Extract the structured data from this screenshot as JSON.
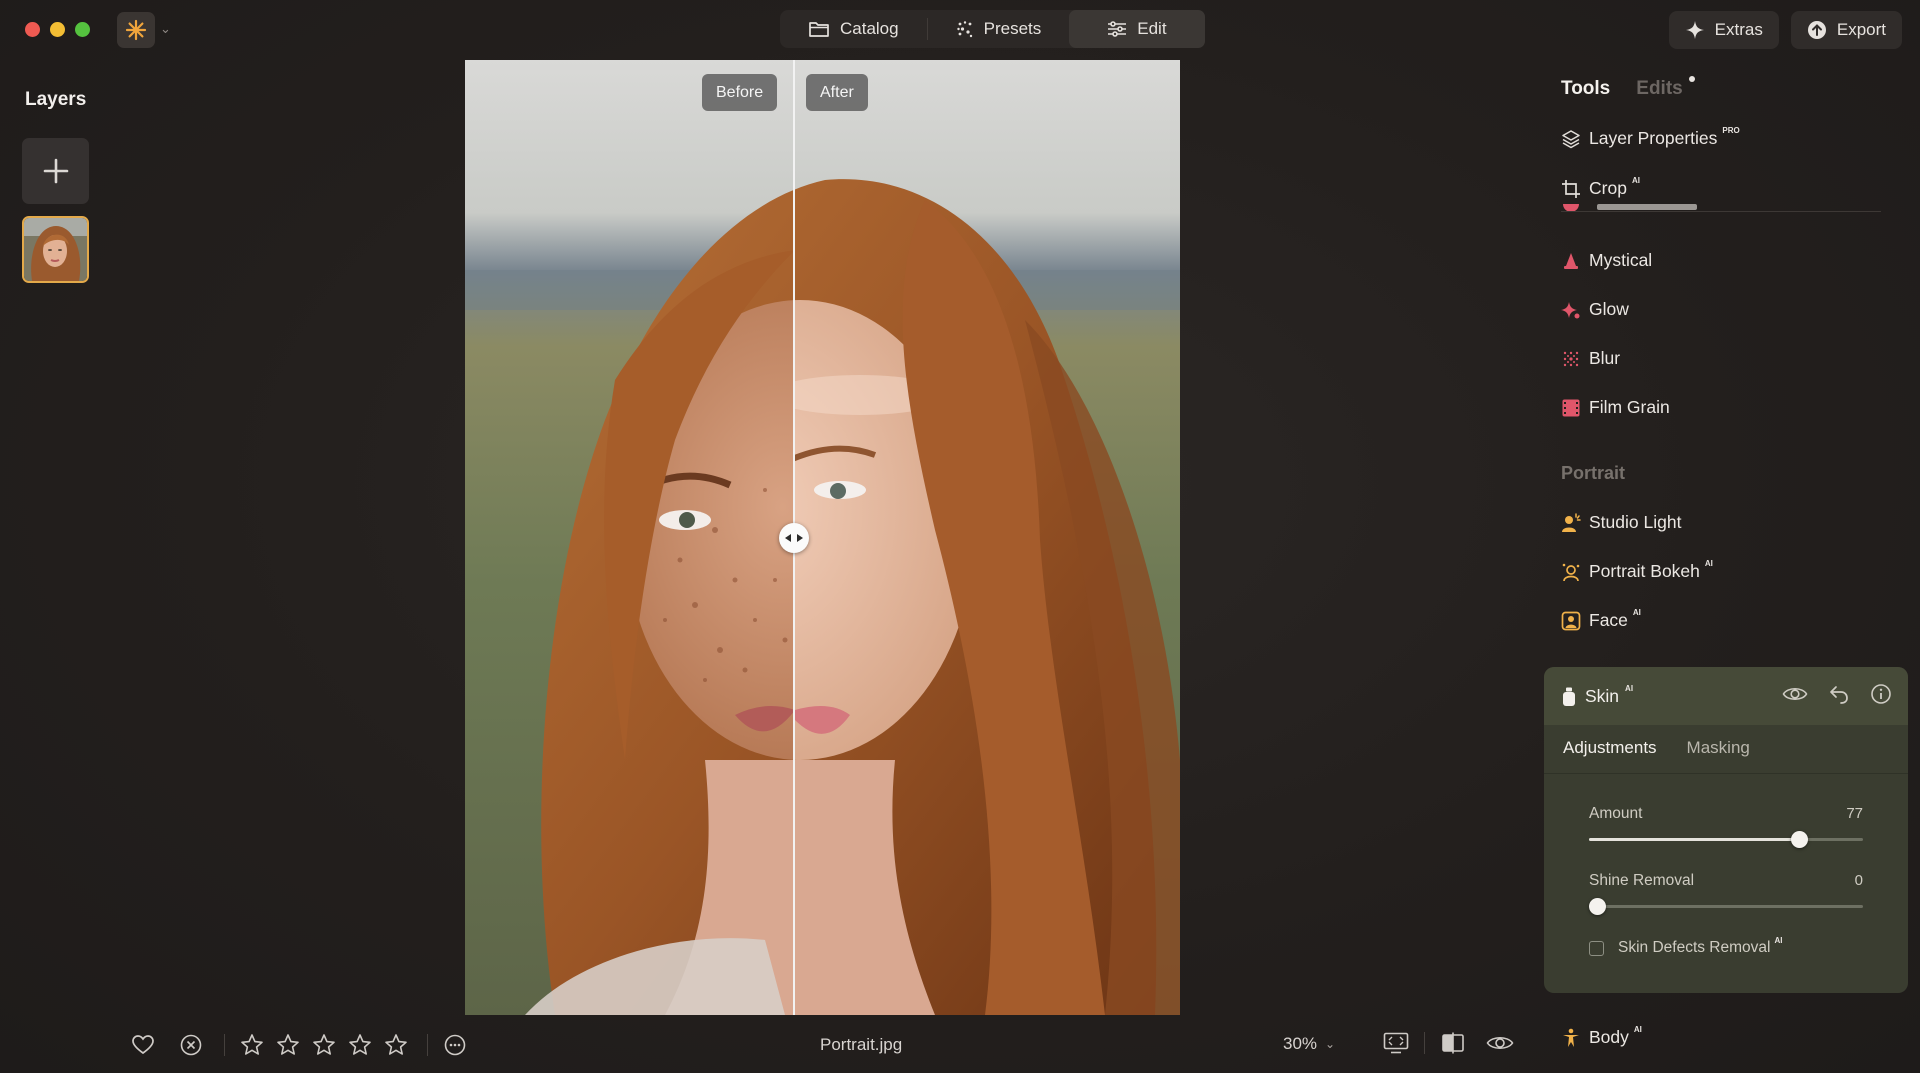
{
  "topbar": {
    "modes": [
      {
        "label": "Catalog",
        "icon": "folder-icon"
      },
      {
        "label": "Presets",
        "icon": "sparkle-dots-icon"
      },
      {
        "label": "Edit",
        "icon": "sliders-icon",
        "active": true
      }
    ],
    "extras_label": "Extras",
    "export_label": "Export"
  },
  "layers": {
    "title": "Layers",
    "add_label": "+"
  },
  "canvas": {
    "before_label": "Before",
    "after_label": "After",
    "filename": "Portrait.jpg",
    "zoom": "30%"
  },
  "rating": {
    "stars": 0,
    "max_stars": 5
  },
  "panel": {
    "tabs": {
      "tools": "Tools",
      "edits": "Edits"
    },
    "tools_top": [
      {
        "label": "Layer Properties",
        "badge": "PRO",
        "icon": "layers-icon"
      },
      {
        "label": "Crop",
        "badge": "AI",
        "icon": "crop-icon"
      }
    ],
    "creative_tools": [
      {
        "label": "Mystical",
        "icon": "mystical-icon"
      },
      {
        "label": "Glow",
        "icon": "glow-icon"
      },
      {
        "label": "Blur",
        "icon": "blur-icon"
      },
      {
        "label": "Film Grain",
        "icon": "film-grain-icon"
      }
    ],
    "portrait_section": "Portrait",
    "portrait_tools": [
      {
        "label": "Studio Light",
        "badge": "",
        "icon": "studio-light-icon"
      },
      {
        "label": "Portrait Bokeh",
        "badge": "AI",
        "icon": "portrait-bokeh-icon"
      },
      {
        "label": "Face",
        "badge": "AI",
        "icon": "face-icon"
      }
    ],
    "skin": {
      "title": "Skin",
      "badge": "AI",
      "tabs": {
        "adjustments": "Adjustments",
        "masking": "Masking"
      },
      "amount": {
        "label": "Amount",
        "value": 77
      },
      "shine": {
        "label": "Shine Removal",
        "value": 0
      },
      "defects": {
        "label": "Skin Defects Removal",
        "badge": "AI",
        "checked": false
      }
    },
    "body": {
      "label": "Body",
      "badge": "AI"
    }
  },
  "colors": {
    "accent_orange": "#e3a94a",
    "skin_panel": "#3a3d30",
    "tool_icon_red": "#e0566a"
  }
}
